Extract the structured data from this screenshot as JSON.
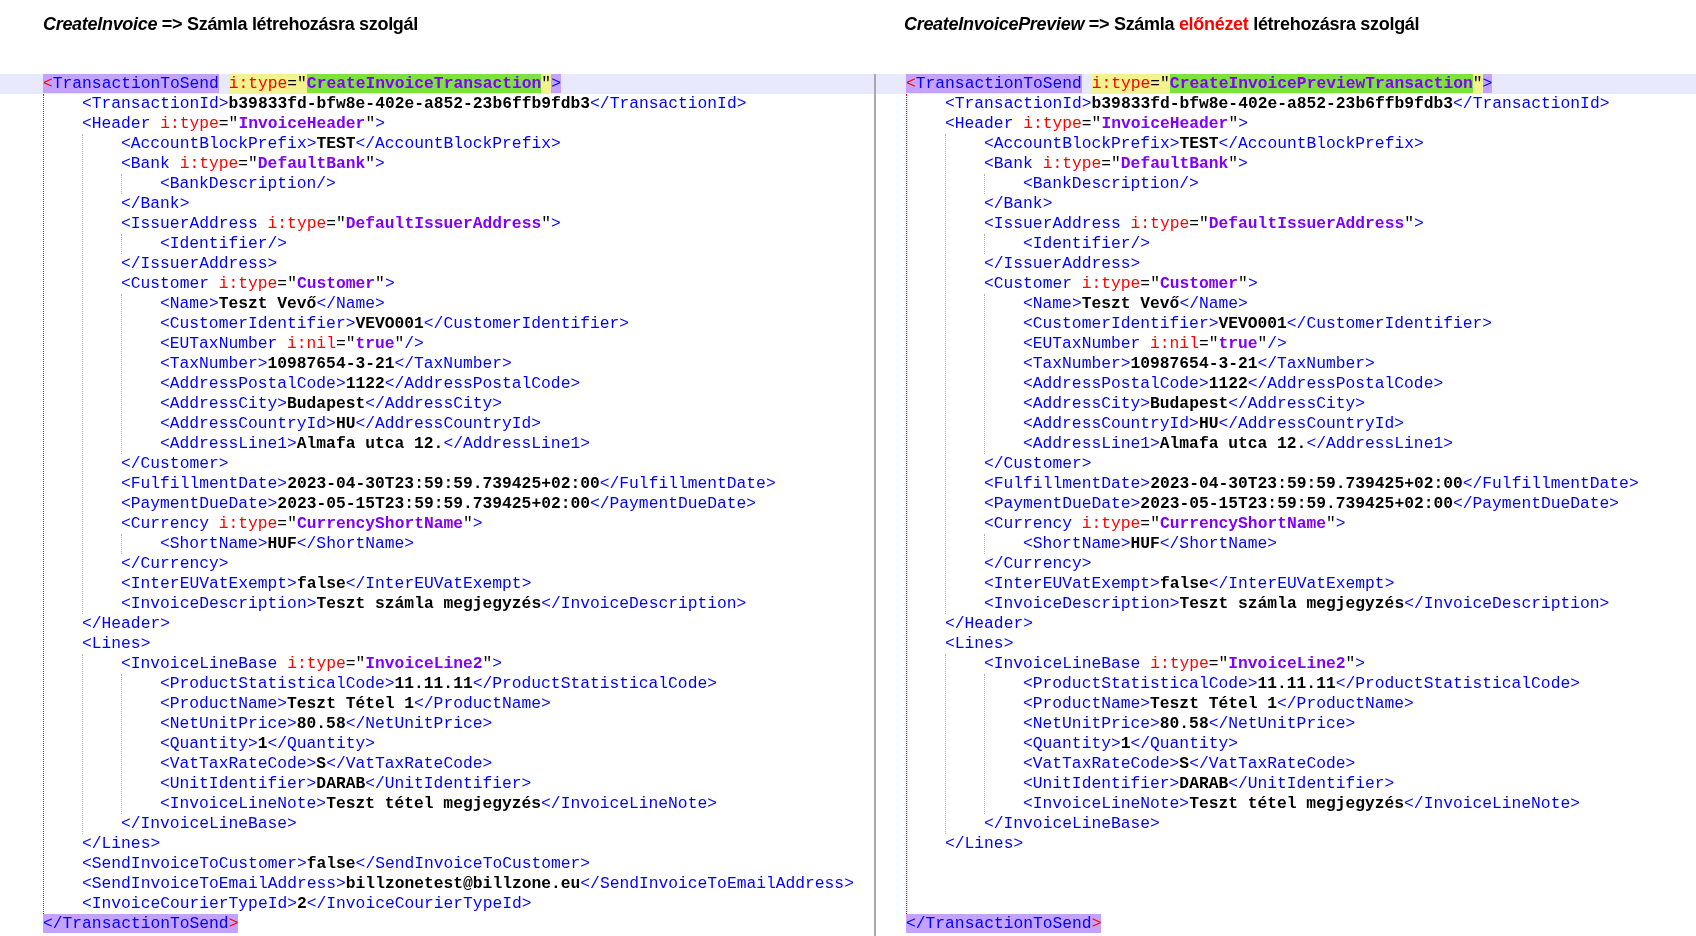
{
  "panels": [
    {
      "heading": {
        "parts": [
          {
            "kind": "italic",
            "text": "CreateInvoice"
          },
          {
            "kind": "plain",
            "text": " => Számla létrehozásra szolgál"
          }
        ]
      },
      "code": {
        "kind": "block",
        "highlighted": true,
        "open": "<TransactionToSend i:type=\"CreateInvoiceTransaction\">",
        "close": "</TransactionToSend>",
        "children": [
          {
            "kind": "line",
            "text": "<TransactionId>b39833fd-bfw8e-402e-a852-23b6ffb9fdb3</TransactionId>"
          },
          {
            "kind": "block",
            "highlighted": false,
            "open": "<Header i:type=\"InvoiceHeader\">",
            "close": "</Header>",
            "children": [
              {
                "kind": "line",
                "text": "<AccountBlockPrefix>TEST</AccountBlockPrefix>"
              },
              {
                "kind": "block",
                "highlighted": false,
                "open": "<Bank i:type=\"DefaultBank\">",
                "close": "</Bank>",
                "children": [
                  {
                    "kind": "line",
                    "text": "<BankDescription/>"
                  }
                ]
              },
              {
                "kind": "block",
                "highlighted": false,
                "open": "<IssuerAddress i:type=\"DefaultIssuerAddress\">",
                "close": "</IssuerAddress>",
                "children": [
                  {
                    "kind": "line",
                    "text": "<Identifier/>"
                  }
                ]
              },
              {
                "kind": "block",
                "highlighted": false,
                "open": "<Customer i:type=\"Customer\">",
                "close": "</Customer>",
                "children": [
                  {
                    "kind": "line",
                    "text": "<Name>Teszt Vevő</Name>"
                  },
                  {
                    "kind": "line",
                    "text": "<CustomerIdentifier>VEVO001</CustomerIdentifier>"
                  },
                  {
                    "kind": "line",
                    "text": "<EUTaxNumber i:nil=\"true\"/>"
                  },
                  {
                    "kind": "line",
                    "text": "<TaxNumber>10987654-3-21</TaxNumber>"
                  },
                  {
                    "kind": "line",
                    "text": "<AddressPostalCode>1122</AddressPostalCode>"
                  },
                  {
                    "kind": "line",
                    "text": "<AddressCity>Budapest</AddressCity>"
                  },
                  {
                    "kind": "line",
                    "text": "<AddressCountryId>HU</AddressCountryId>"
                  },
                  {
                    "kind": "line",
                    "text": "<AddressLine1>Almafa utca 12.</AddressLine1>"
                  }
                ]
              },
              {
                "kind": "line",
                "text": "<FulfillmentDate>2023-04-30T23:59:59.739425+02:00</FulfillmentDate>"
              },
              {
                "kind": "line",
                "text": "<PaymentDueDate>2023-05-15T23:59:59.739425+02:00</PaymentDueDate>"
              },
              {
                "kind": "block",
                "highlighted": false,
                "open": "<Currency i:type=\"CurrencyShortName\">",
                "close": "</Currency>",
                "children": [
                  {
                    "kind": "line",
                    "text": "<ShortName>HUF</ShortName>"
                  }
                ]
              },
              {
                "kind": "line",
                "text": "<InterEUVatExempt>false</InterEUVatExempt>"
              },
              {
                "kind": "line",
                "text": "<InvoiceDescription>Teszt számla megjegyzés</InvoiceDescription>"
              }
            ]
          },
          {
            "kind": "block",
            "highlighted": false,
            "open": "<Lines>",
            "close": "</Lines>",
            "children": [
              {
                "kind": "block",
                "highlighted": false,
                "open": "<InvoiceLineBase i:type=\"InvoiceLine2\">",
                "close": "</InvoiceLineBase>",
                "children": [
                  {
                    "kind": "line",
                    "text": "<ProductStatisticalCode>11.11.11</ProductStatisticalCode>"
                  },
                  {
                    "kind": "line",
                    "text": "<ProductName>Teszt Tétel 1</ProductName>"
                  },
                  {
                    "kind": "line",
                    "text": "<NetUnitPrice>80.58</NetUnitPrice>"
                  },
                  {
                    "kind": "line",
                    "text": "<Quantity>1</Quantity>"
                  },
                  {
                    "kind": "line",
                    "text": "<VatTaxRateCode>S</VatTaxRateCode>"
                  },
                  {
                    "kind": "line",
                    "text": "<UnitIdentifier>DARAB</UnitIdentifier>"
                  },
                  {
                    "kind": "line",
                    "text": "<InvoiceLineNote>Teszt tétel megjegyzés</InvoiceLineNote>"
                  }
                ]
              }
            ]
          },
          {
            "kind": "line",
            "text": "<SendInvoiceToCustomer>false</SendInvoiceToCustomer>"
          },
          {
            "kind": "line",
            "text": "<SendInvoiceToEmailAddress>billzonetest@billzone.eu</SendInvoiceToEmailAddress>"
          },
          {
            "kind": "line",
            "text": "<InvoiceCourierTypeId>2</InvoiceCourierTypeId>"
          }
        ]
      }
    },
    {
      "heading": {
        "parts": [
          {
            "kind": "italic",
            "text": "CreateInvoicePreview"
          },
          {
            "kind": "plain",
            "text": " => Számla "
          },
          {
            "kind": "accent",
            "text": "előnézet"
          },
          {
            "kind": "plain",
            "text": " létrehozásra szolgál"
          }
        ]
      },
      "code": {
        "kind": "block",
        "highlighted": true,
        "open": "<TransactionToSend i:type=\"CreateInvoicePreviewTransaction\">",
        "close": "</TransactionToSend>",
        "children": [
          {
            "kind": "line",
            "text": "<TransactionId>b39833fd-bfw8e-402e-a852-23b6ffb9fdb3</TransactionId>"
          },
          {
            "kind": "block",
            "highlighted": false,
            "open": "<Header i:type=\"InvoiceHeader\">",
            "close": "</Header>",
            "children": [
              {
                "kind": "line",
                "text": "<AccountBlockPrefix>TEST</AccountBlockPrefix>"
              },
              {
                "kind": "block",
                "highlighted": false,
                "open": "<Bank i:type=\"DefaultBank\">",
                "close": "</Bank>",
                "children": [
                  {
                    "kind": "line",
                    "text": "<BankDescription/>"
                  }
                ]
              },
              {
                "kind": "block",
                "highlighted": false,
                "open": "<IssuerAddress i:type=\"DefaultIssuerAddress\">",
                "close": "</IssuerAddress>",
                "children": [
                  {
                    "kind": "line",
                    "text": "<Identifier/>"
                  }
                ]
              },
              {
                "kind": "block",
                "highlighted": false,
                "open": "<Customer i:type=\"Customer\">",
                "close": "</Customer>",
                "children": [
                  {
                    "kind": "line",
                    "text": "<Name>Teszt Vevő</Name>"
                  },
                  {
                    "kind": "line",
                    "text": "<CustomerIdentifier>VEVO001</CustomerIdentifier>"
                  },
                  {
                    "kind": "line",
                    "text": "<EUTaxNumber i:nil=\"true\"/>"
                  },
                  {
                    "kind": "line",
                    "text": "<TaxNumber>10987654-3-21</TaxNumber>"
                  },
                  {
                    "kind": "line",
                    "text": "<AddressPostalCode>1122</AddressPostalCode>"
                  },
                  {
                    "kind": "line",
                    "text": "<AddressCity>Budapest</AddressCity>"
                  },
                  {
                    "kind": "line",
                    "text": "<AddressCountryId>HU</AddressCountryId>"
                  },
                  {
                    "kind": "line",
                    "text": "<AddressLine1>Almafa utca 12.</AddressLine1>"
                  }
                ]
              },
              {
                "kind": "line",
                "text": "<FulfillmentDate>2023-04-30T23:59:59.739425+02:00</FulfillmentDate>"
              },
              {
                "kind": "line",
                "text": "<PaymentDueDate>2023-05-15T23:59:59.739425+02:00</PaymentDueDate>"
              },
              {
                "kind": "block",
                "highlighted": false,
                "open": "<Currency i:type=\"CurrencyShortName\">",
                "close": "</Currency>",
                "children": [
                  {
                    "kind": "line",
                    "text": "<ShortName>HUF</ShortName>"
                  }
                ]
              },
              {
                "kind": "line",
                "text": "<InterEUVatExempt>false</InterEUVatExempt>"
              },
              {
                "kind": "line",
                "text": "<InvoiceDescription>Teszt számla megjegyzés</InvoiceDescription>"
              }
            ]
          },
          {
            "kind": "block",
            "highlighted": false,
            "open": "<Lines>",
            "close": "</Lines>",
            "children": [
              {
                "kind": "block",
                "highlighted": false,
                "open": "<InvoiceLineBase i:type=\"InvoiceLine2\">",
                "close": "</InvoiceLineBase>",
                "children": [
                  {
                    "kind": "line",
                    "text": "<ProductStatisticalCode>11.11.11</ProductStatisticalCode>"
                  },
                  {
                    "kind": "line",
                    "text": "<ProductName>Teszt Tétel 1</ProductName>"
                  },
                  {
                    "kind": "line",
                    "text": "<NetUnitPrice>80.58</NetUnitPrice>"
                  },
                  {
                    "kind": "line",
                    "text": "<Quantity>1</Quantity>"
                  },
                  {
                    "kind": "line",
                    "text": "<VatTaxRateCode>S</VatTaxRateCode>"
                  },
                  {
                    "kind": "line",
                    "text": "<UnitIdentifier>DARAB</UnitIdentifier>"
                  },
                  {
                    "kind": "line",
                    "text": "<InvoiceLineNote>Teszt tétel megjegyzés</InvoiceLineNote>"
                  }
                ]
              }
            ]
          },
          {
            "kind": "blank"
          },
          {
            "kind": "blank"
          },
          {
            "kind": "blank"
          }
        ]
      }
    }
  ]
}
